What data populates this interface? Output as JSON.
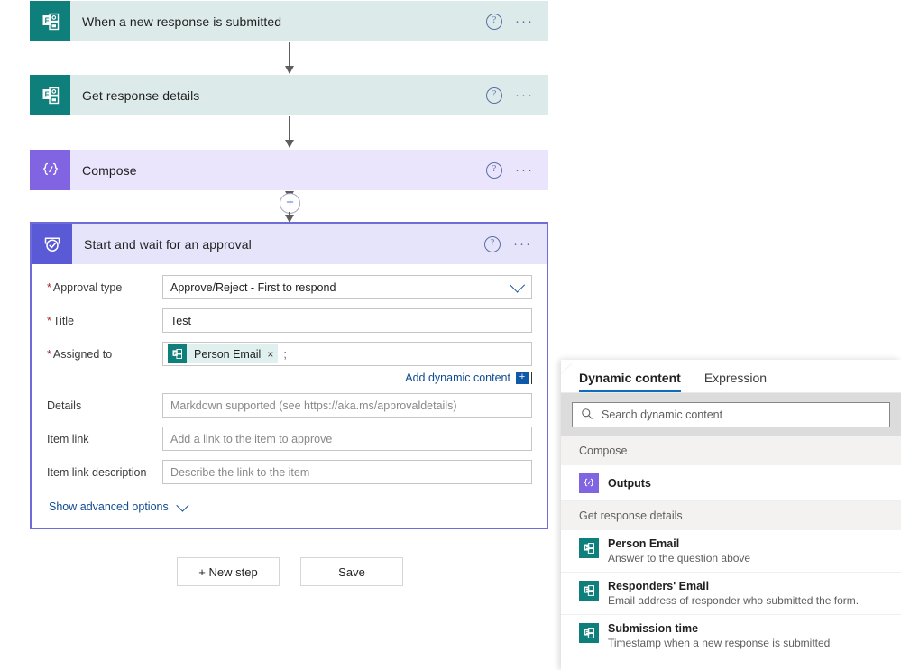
{
  "flow": {
    "steps": [
      {
        "title": "When a new response is submitted",
        "icon": "microsoft-forms-icon",
        "type": "forms"
      },
      {
        "title": "Get response details",
        "icon": "microsoft-forms-icon",
        "type": "forms"
      },
      {
        "title": "Compose",
        "icon": "compose-icon",
        "type": "compose"
      }
    ],
    "approval": {
      "title": "Start and wait for an approval",
      "icon": "approvals-icon",
      "fields": [
        {
          "label": "Approval type",
          "required": true,
          "value": "Approve/Reject - First to respond",
          "control": "dropdown"
        },
        {
          "label": "Title",
          "required": true,
          "value": "Test",
          "control": "text"
        },
        {
          "label": "Assigned to",
          "required": true,
          "control": "token",
          "token_label": "Person Email",
          "token_remove": "×",
          "token_separator": ";"
        },
        {
          "label": "Details",
          "required": false,
          "placeholder": "Markdown supported (see https://aka.ms/approvaldetails)",
          "control": "text"
        },
        {
          "label": "Item link",
          "required": false,
          "placeholder": "Add a link to the item to approve",
          "control": "text"
        },
        {
          "label": "Item link description",
          "required": false,
          "placeholder": "Describe the link to the item",
          "control": "text"
        }
      ],
      "add_dynamic_content": "Add dynamic content",
      "add_dynamic_plus": "+",
      "show_advanced_options": "Show advanced options"
    },
    "add_step_symbol": "+",
    "help_symbol": "?",
    "ellipsis_symbol": "···"
  },
  "buttons": {
    "new_step": "+ New step",
    "save": "Save"
  },
  "panel": {
    "tabs": [
      {
        "label": "Dynamic content",
        "active": true
      },
      {
        "label": "Expression",
        "active": false
      }
    ],
    "search_placeholder": "Search dynamic content",
    "search_value": "",
    "groups": [
      {
        "name": "Compose",
        "items": [
          {
            "title": "Outputs",
            "description": "",
            "icon": "compose-icon"
          }
        ]
      },
      {
        "name": "Get response details",
        "items": [
          {
            "title": "Person Email",
            "description": "Answer to the question above",
            "icon": "microsoft-forms-icon"
          },
          {
            "title": "Responders' Email",
            "description": "Email address of responder who submitted the form.",
            "icon": "microsoft-forms-icon"
          },
          {
            "title": "Submission time",
            "description": "Timestamp when a new response is submitted",
            "icon": "microsoft-forms-icon"
          }
        ]
      }
    ]
  },
  "colors": {
    "forms_teal": "#0f7f7c",
    "forms_card_bg": "#dcebea",
    "compose_purple": "#8164e2",
    "compose_card_bg": "#eae4fc",
    "approval_indigo": "#5a5ad6",
    "approval_card_bg": "#e6e4fb",
    "approval_border": "#6f6bd8",
    "link_blue": "#0f4c91",
    "tab_accent": "#0f6cbd",
    "required_red": "#a4262c"
  }
}
